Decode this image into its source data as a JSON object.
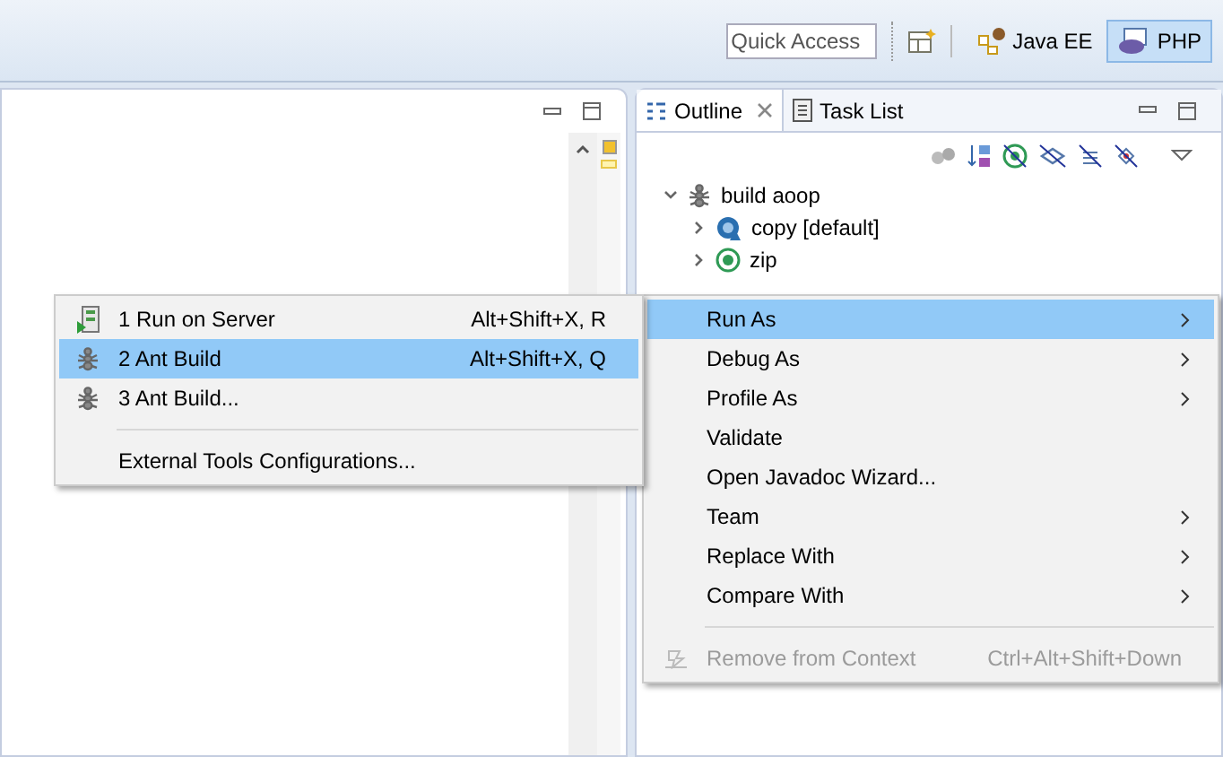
{
  "toolbar": {
    "quick_access": {
      "placeholder": "Quick Access"
    },
    "perspectives": [
      {
        "label": "Java EE",
        "selected": false
      },
      {
        "label": "PHP",
        "selected": true
      }
    ]
  },
  "outline_panel": {
    "tabs": [
      {
        "label": "Outline",
        "selected": true
      },
      {
        "label": "Task List",
        "selected": false
      }
    ],
    "tree": [
      {
        "label": "build aoop",
        "expanded": true,
        "selected": false,
        "children": [
          {
            "label": "copy [default]",
            "kind": "default_target",
            "expanded": false,
            "selected": false
          },
          {
            "label": "zip",
            "kind": "target",
            "expanded": false,
            "selected": false
          }
        ]
      }
    ]
  },
  "context_menu": {
    "items": [
      {
        "kind": "item",
        "label": "Run As",
        "submenu": true,
        "selected": true,
        "disabled": false
      },
      {
        "kind": "item",
        "label": "Debug As",
        "submenu": true,
        "selected": false,
        "disabled": false
      },
      {
        "kind": "item",
        "label": "Profile As",
        "submenu": true,
        "selected": false,
        "disabled": false
      },
      {
        "kind": "item",
        "label": "Validate",
        "submenu": false,
        "selected": false,
        "disabled": false
      },
      {
        "kind": "item",
        "label": "Open Javadoc Wizard...",
        "submenu": false,
        "selected": false,
        "disabled": false
      },
      {
        "kind": "item",
        "label": "Team",
        "submenu": true,
        "selected": false,
        "disabled": false
      },
      {
        "kind": "item",
        "label": "Replace With",
        "submenu": true,
        "selected": false,
        "disabled": false
      },
      {
        "kind": "item",
        "label": "Compare With",
        "submenu": true,
        "selected": false,
        "disabled": false
      },
      {
        "kind": "separator"
      },
      {
        "kind": "context_action",
        "label": "Remove from Context",
        "shortcut": "Ctrl+Alt+Shift+Down",
        "submenu": false,
        "selected": false,
        "disabled": true
      }
    ]
  },
  "run_as_menu": {
    "items": [
      {
        "kind": "server_run",
        "label": "1 Run on Server",
        "shortcut": "Alt+Shift+X, R",
        "selected": false
      },
      {
        "kind": "ant_build",
        "label": "2 Ant Build",
        "shortcut": "Alt+Shift+X, Q",
        "selected": true
      },
      {
        "kind": "ant_build",
        "label": "3 Ant Build...",
        "selected": false
      },
      {
        "kind": "separator"
      },
      {
        "kind": "item",
        "label": "External Tools Configurations...",
        "selected": false
      }
    ]
  }
}
